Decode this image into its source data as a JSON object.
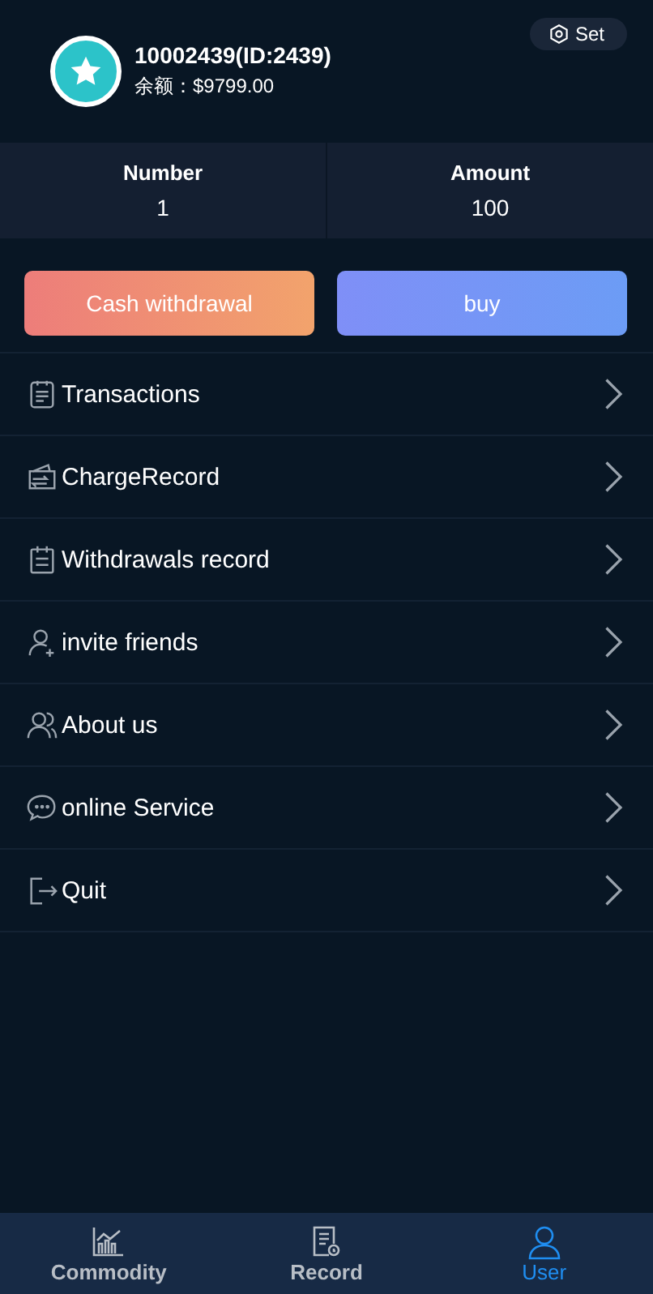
{
  "profile": {
    "name": "10002439(ID:2439)",
    "balance": "余额：$9799.00",
    "settings_button": "Set"
  },
  "stats": [
    {
      "label": "Number",
      "value": "1"
    },
    {
      "label": "Amount",
      "value": "100"
    }
  ],
  "actions": [
    {
      "label": "Cash withdrawal",
      "kind": "warm"
    },
    {
      "label": "buy",
      "kind": "cool"
    }
  ],
  "menu": [
    {
      "label": "Transactions",
      "kind": "clipboard"
    },
    {
      "label": "ChargeRecord",
      "kind": "wallet"
    },
    {
      "label": "Withdrawals record",
      "kind": "calendar"
    },
    {
      "label": "invite friends",
      "kind": "add-user"
    },
    {
      "label": "About us",
      "kind": "users"
    },
    {
      "label": "online Service",
      "kind": "chat"
    },
    {
      "label": "Quit",
      "kind": "exit"
    }
  ],
  "tabbar": [
    {
      "label": "Commodity",
      "kind": "chart",
      "selected": false
    },
    {
      "label": "Record",
      "kind": "record",
      "selected": false
    },
    {
      "label": "User",
      "kind": "user",
      "selected": true
    }
  ]
}
